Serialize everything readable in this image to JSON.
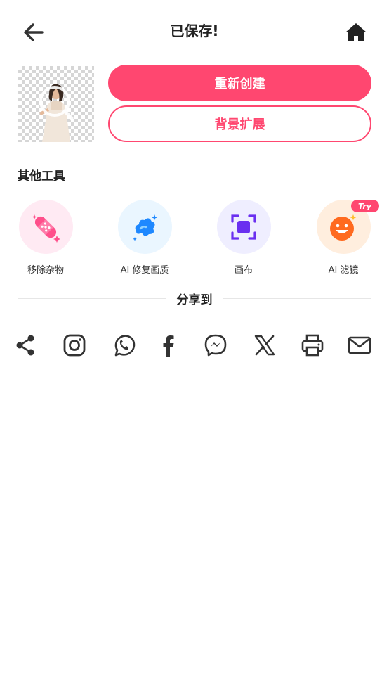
{
  "header": {
    "title": "已保存!"
  },
  "actions": {
    "recreate_label": "重新创建",
    "expand_bg_label": "背景扩展"
  },
  "tools": {
    "section_title": "其他工具",
    "items": [
      {
        "label": "移除杂物",
        "icon": "bandage-icon",
        "bg": "#ffeaf3"
      },
      {
        "label": "AI 修复画质",
        "icon": "repair-sparkle-icon",
        "bg": "#eaf6ff"
      },
      {
        "label": "画布",
        "icon": "canvas-frame-icon",
        "bg": "#efeeff"
      },
      {
        "label": "AI 滤镜",
        "icon": "smiley-filter-icon",
        "bg": "#ffeede",
        "badge": "Try"
      }
    ]
  },
  "share": {
    "title": "分享到",
    "targets": [
      "share-icon",
      "instagram-icon",
      "whatsapp-icon",
      "facebook-icon",
      "messenger-icon",
      "x-icon",
      "print-icon",
      "mail-icon"
    ]
  },
  "colors": {
    "accent": "#ff4770",
    "icon_dark": "#333333"
  }
}
